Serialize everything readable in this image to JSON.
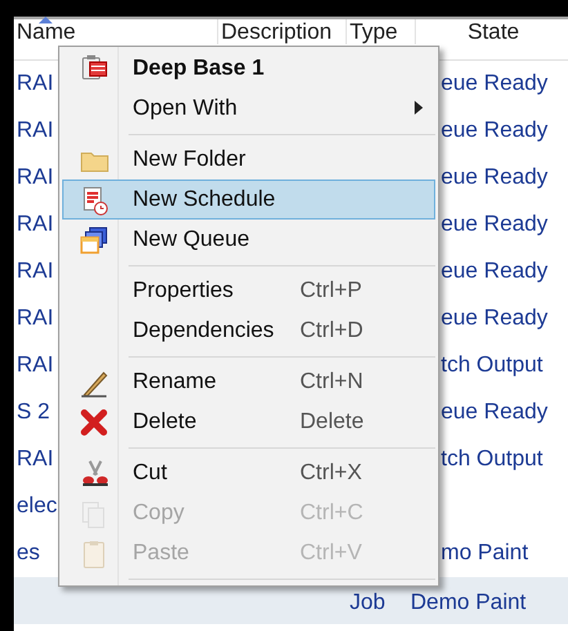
{
  "table": {
    "columns": [
      {
        "label": "Name",
        "sorted": true
      },
      {
        "label": "Description",
        "sorted": false
      },
      {
        "label": "Type",
        "sorted": false
      },
      {
        "label": "State",
        "sorted": false
      }
    ],
    "rows": [
      {
        "name": "RAI",
        "state": "eue Ready",
        "selected": false
      },
      {
        "name": "RAI",
        "state": "eue Ready",
        "selected": false
      },
      {
        "name": "RAI",
        "state": "eue Ready",
        "selected": false
      },
      {
        "name": "RAI",
        "state": "eue Ready",
        "selected": false
      },
      {
        "name": "RAI",
        "state": "eue Ready",
        "selected": false
      },
      {
        "name": "RAI",
        "state": "eue Ready",
        "selected": false
      },
      {
        "name": "RAI",
        "state": "tch Output",
        "selected": false
      },
      {
        "name": "S 2",
        "state": "eue Ready",
        "selected": false
      },
      {
        "name": "RAI",
        "state": "tch Output",
        "selected": false
      },
      {
        "name": "elec",
        "selected": false
      },
      {
        "name": "es",
        "state": "mo Paint",
        "selected": false
      },
      {
        "type": "Job",
        "state": "Demo Paint",
        "selected": true
      }
    ]
  },
  "context_menu": {
    "items": [
      {
        "kind": "item",
        "label": "Deep Base 1",
        "bold": true,
        "selected": false,
        "disabled": false
      },
      {
        "kind": "item",
        "label": "Open With",
        "submenu": true,
        "selected": false,
        "disabled": false
      },
      {
        "kind": "separator"
      },
      {
        "kind": "item",
        "label": "New Folder",
        "selected": false,
        "disabled": false
      },
      {
        "kind": "item",
        "label": "New Schedule",
        "selected": true,
        "disabled": false
      },
      {
        "kind": "item",
        "label": "New Queue",
        "selected": false,
        "disabled": false
      },
      {
        "kind": "separator"
      },
      {
        "kind": "item",
        "label": "Properties",
        "shortcut": "Ctrl+P",
        "selected": false,
        "disabled": false
      },
      {
        "kind": "item",
        "label": "Dependencies",
        "shortcut": "Ctrl+D",
        "selected": false,
        "disabled": false
      },
      {
        "kind": "separator"
      },
      {
        "kind": "item",
        "label": "Rename",
        "shortcut": "Ctrl+N",
        "selected": false,
        "disabled": false
      },
      {
        "kind": "item",
        "label": "Delete",
        "shortcut": "Delete",
        "selected": false,
        "disabled": false
      },
      {
        "kind": "separator"
      },
      {
        "kind": "item",
        "label": "Cut",
        "shortcut": "Ctrl+X",
        "selected": false,
        "disabled": false
      },
      {
        "kind": "item",
        "label": "Copy",
        "shortcut": "Ctrl+C",
        "selected": false,
        "disabled": true
      },
      {
        "kind": "item",
        "label": "Paste",
        "shortcut": "Ctrl+V",
        "selected": false,
        "disabled": true
      },
      {
        "kind": "separator"
      }
    ]
  }
}
